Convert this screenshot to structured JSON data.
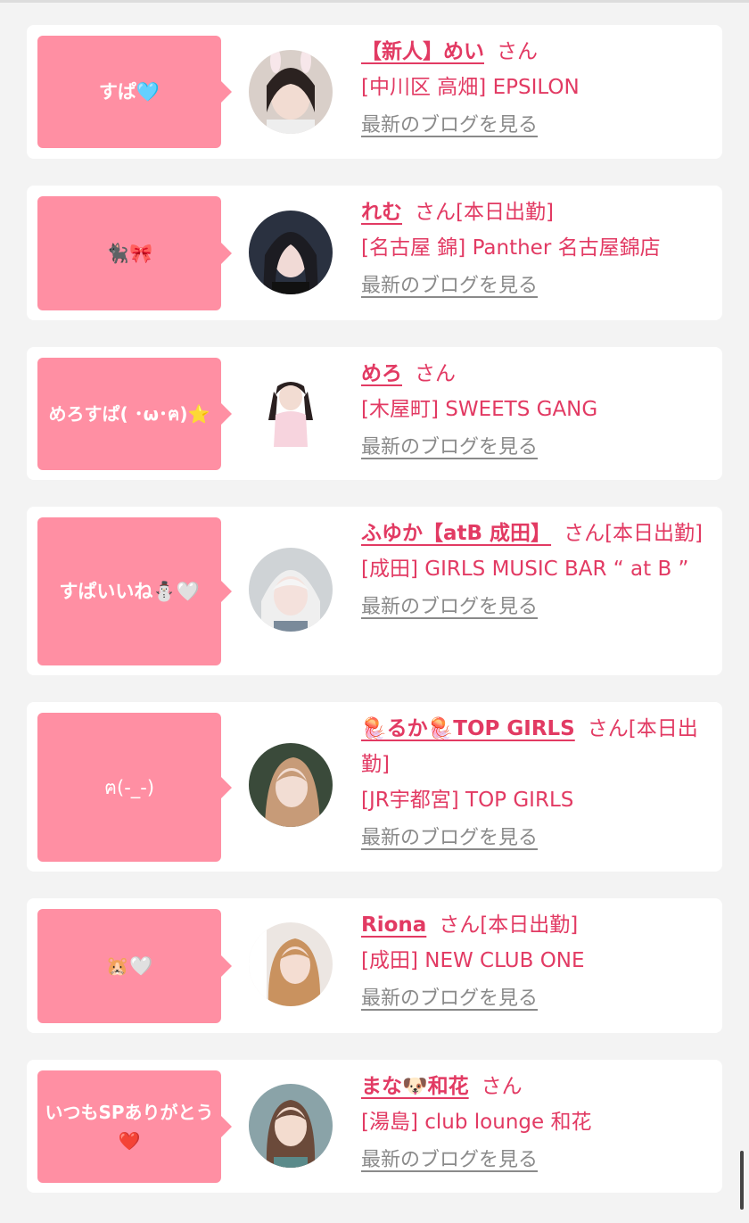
{
  "accent": "#e23a63",
  "bubble_color": "#ff8fa3",
  "blog_link_label": "最新のブログを見る",
  "honorific": "さん",
  "cards": [
    {
      "bubble": "すぱ🩵",
      "name": "【新人】めい",
      "status": "",
      "shop": "[中川区 高畑] EPSILON"
    },
    {
      "bubble": "🐈‍⬛🎀",
      "name": "れむ",
      "status": "[本日出勤]",
      "shop": "[名古屋 錦] Panther 名古屋錦店"
    },
    {
      "bubble": "めろすぱ( ･ω･ฅ)⭐️",
      "name": "めろ",
      "status": "",
      "shop": "[木屋町] SWEETS GANG"
    },
    {
      "bubble": "すぱいいね⛄️🤍",
      "name": "ふゆか【atB 成田】",
      "status": "[本日出勤]",
      "shop": "[成田] GIRLS MUSIC BAR “ at B ”"
    },
    {
      "bubble": "ฅ(-_-)",
      "name": "🪼るか🪼TOP GIRLS",
      "status": "[本日出勤]",
      "shop": "[JR宇都宮] TOP GIRLS"
    },
    {
      "bubble": "🐹🤍",
      "name": "Riona",
      "status": "[本日出勤]",
      "shop": "[成田] NEW CLUB ONE"
    },
    {
      "bubble": "いつもSPありがとう❤️",
      "name": "まな🐶和花",
      "status": "",
      "shop": "[湯島] club lounge 和花"
    }
  ]
}
